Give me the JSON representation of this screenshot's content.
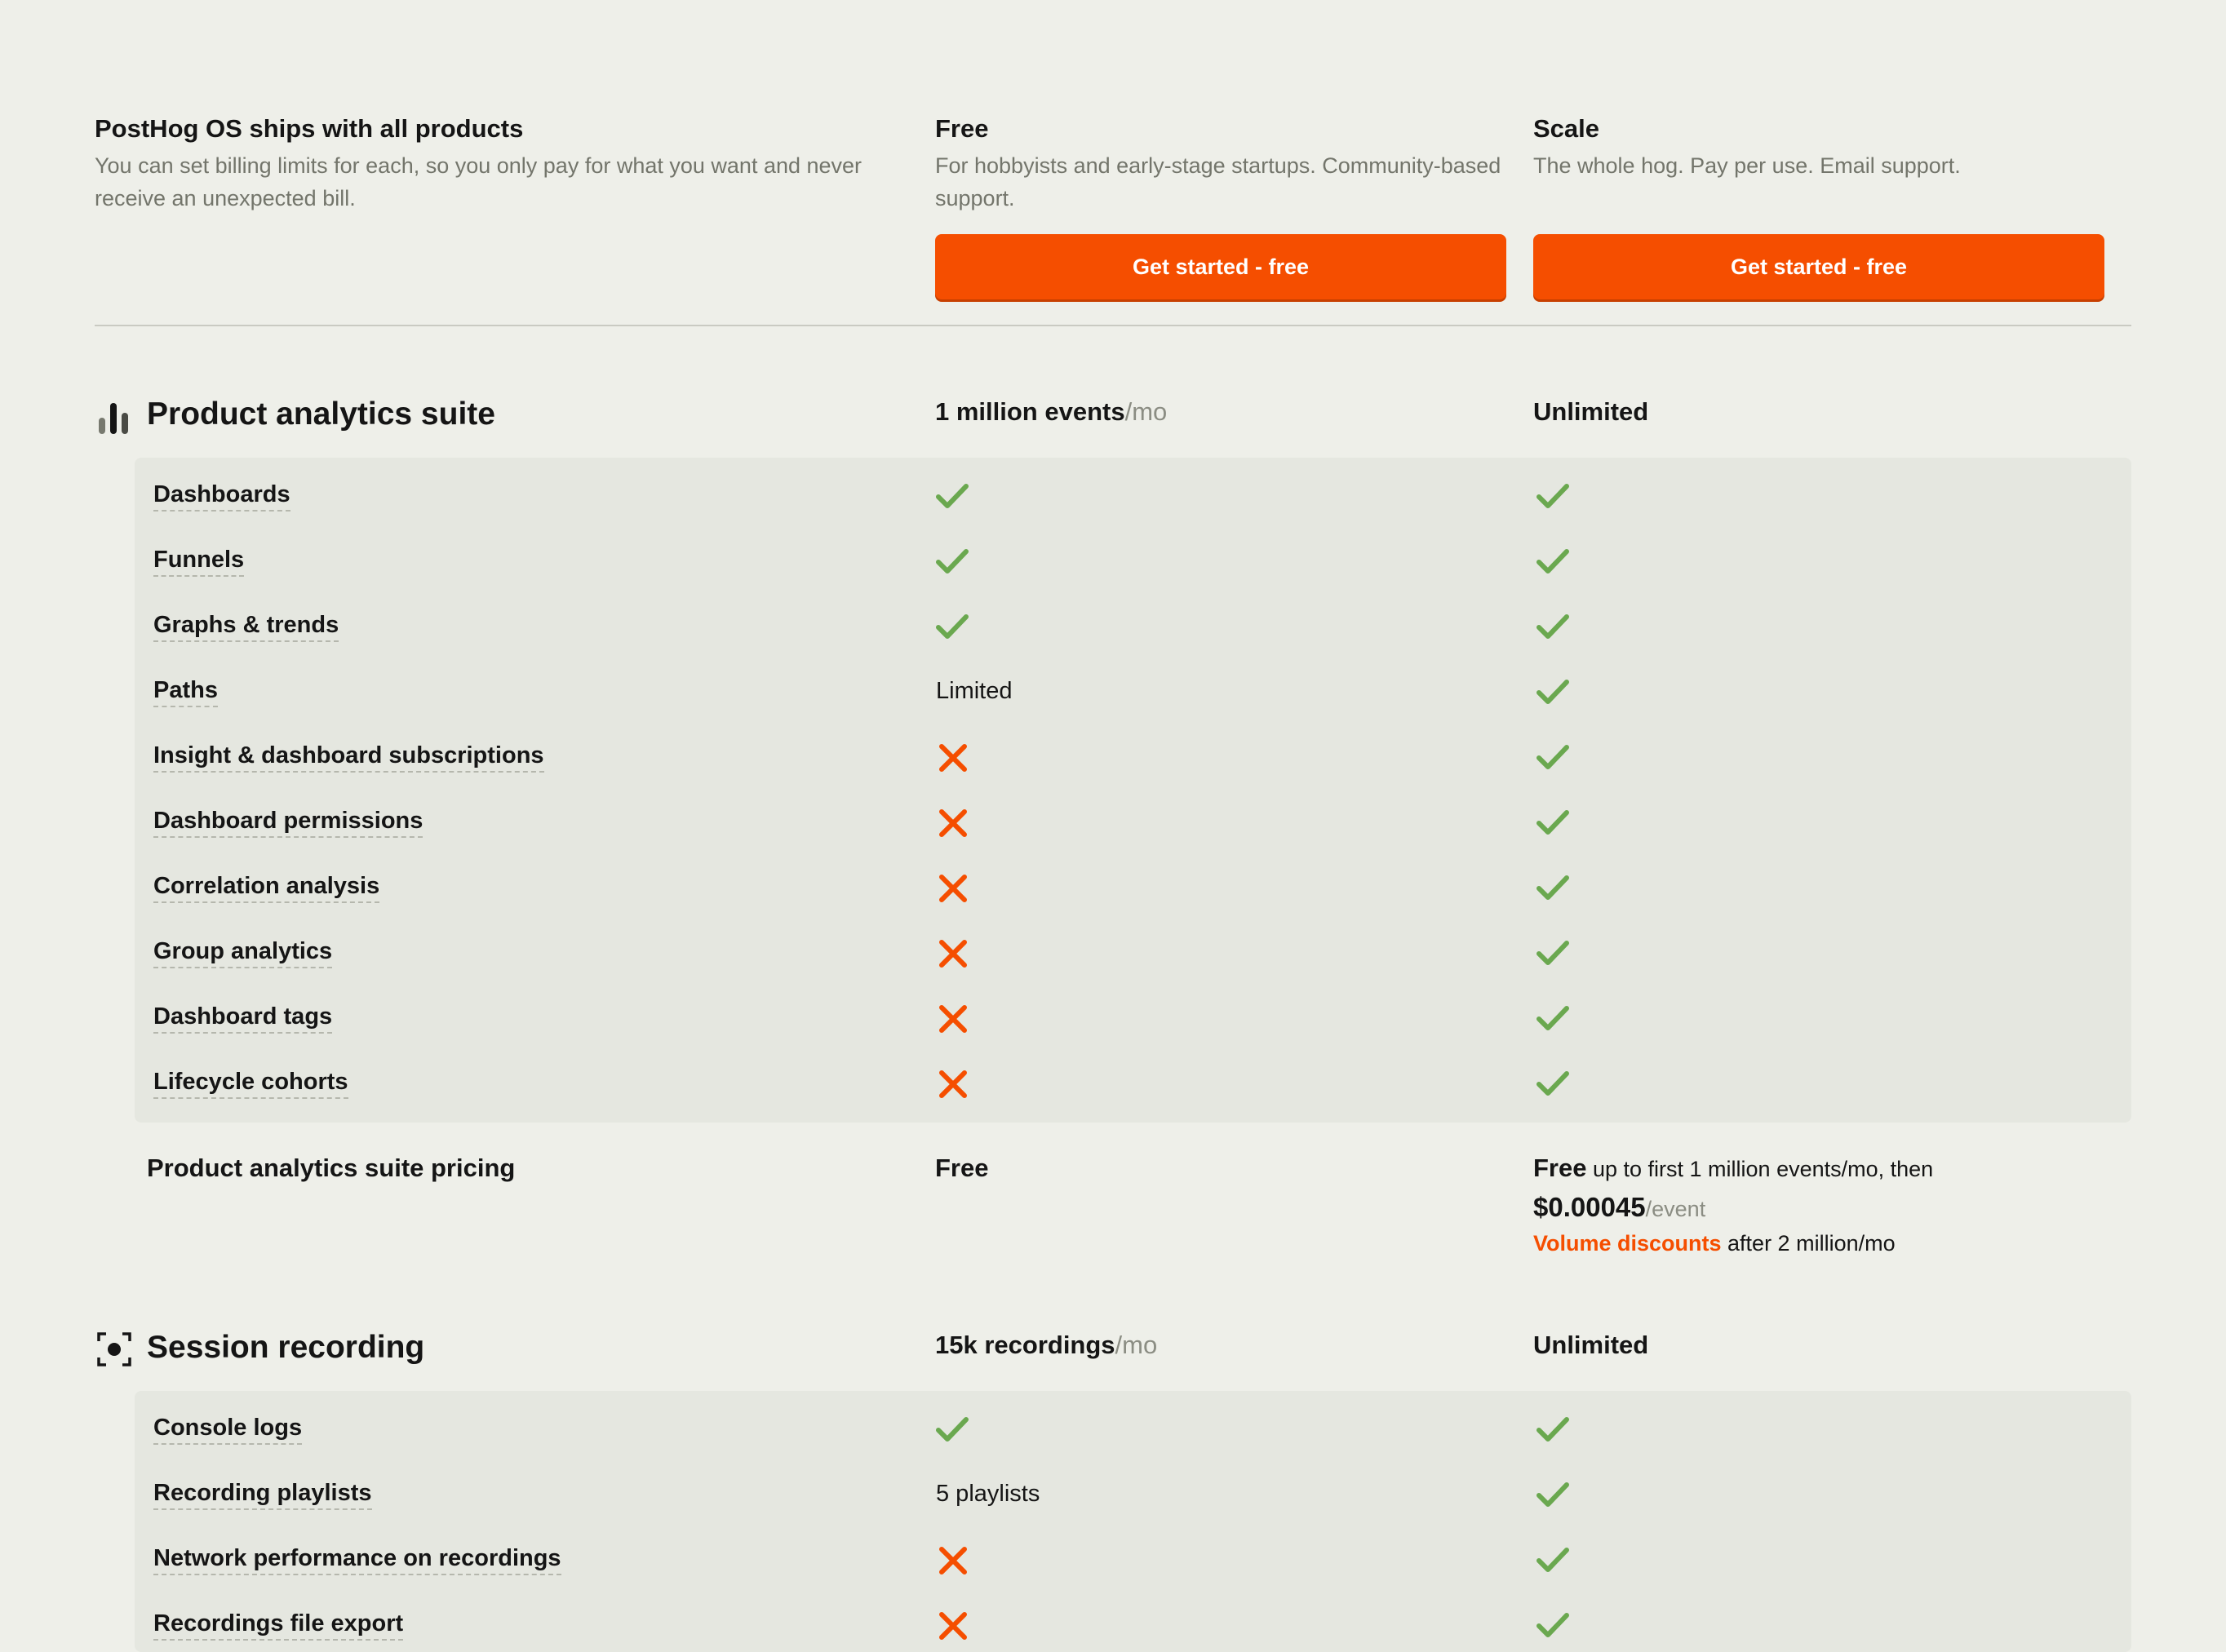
{
  "header": {
    "title": "PostHog OS ships with all products",
    "description": "You can set billing limits for each, so you only pay for what you want and never receive an unexpected bill.",
    "plans": [
      {
        "name": "Free",
        "description": "For hobbyists and early-stage startups. Community-based support.",
        "cta": "Get started - free"
      },
      {
        "name": "Scale",
        "description": "The whole hog. Pay per use. Email support.",
        "cta": "Get started - free"
      }
    ]
  },
  "sections": [
    {
      "title": "Product analytics suite",
      "icon": "bar-chart-icon",
      "free_limit": {
        "value": "1 million events",
        "unit": "/mo"
      },
      "scale_limit": "Unlimited",
      "features": [
        {
          "name": "Dashboards",
          "free": "check",
          "scale": "check"
        },
        {
          "name": "Funnels",
          "free": "check",
          "scale": "check"
        },
        {
          "name": "Graphs & trends",
          "free": "check",
          "scale": "check"
        },
        {
          "name": "Paths",
          "free": "Limited",
          "scale": "check"
        },
        {
          "name": "Insight & dashboard subscriptions",
          "free": "cross",
          "scale": "check"
        },
        {
          "name": "Dashboard permissions",
          "free": "cross",
          "scale": "check"
        },
        {
          "name": "Correlation analysis",
          "free": "cross",
          "scale": "check"
        },
        {
          "name": "Group analytics",
          "free": "cross",
          "scale": "check"
        },
        {
          "name": "Dashboard tags",
          "free": "cross",
          "scale": "check"
        },
        {
          "name": "Lifecycle cohorts",
          "free": "cross",
          "scale": "check"
        }
      ],
      "pricing": {
        "label": "Product analytics suite pricing",
        "free": "Free",
        "scale_prefix": "Free",
        "scale_text": " up to first 1 million events/mo, then",
        "scale_amount": "$0.00045",
        "scale_unit": "/event",
        "discount_link": "Volume discounts",
        "discount_text": " after 2 million/mo"
      }
    },
    {
      "title": "Session recording",
      "icon": "record-icon",
      "free_limit": {
        "value": "15k recordings",
        "unit": "/mo"
      },
      "scale_limit": "Unlimited",
      "features": [
        {
          "name": "Console logs",
          "free": "check",
          "scale": "check"
        },
        {
          "name": "Recording playlists",
          "free": "5 playlists",
          "scale": "check"
        },
        {
          "name": "Network performance on recordings",
          "free": "cross",
          "scale": "check"
        },
        {
          "name": "Recordings file export",
          "free": "cross",
          "scale": "check"
        }
      ]
    }
  ],
  "colors": {
    "accent": "#F54E00",
    "check": "#6AA84F",
    "cross": "#F54E00",
    "background": "#EEEFE9",
    "panel": "#E5E7E0"
  }
}
